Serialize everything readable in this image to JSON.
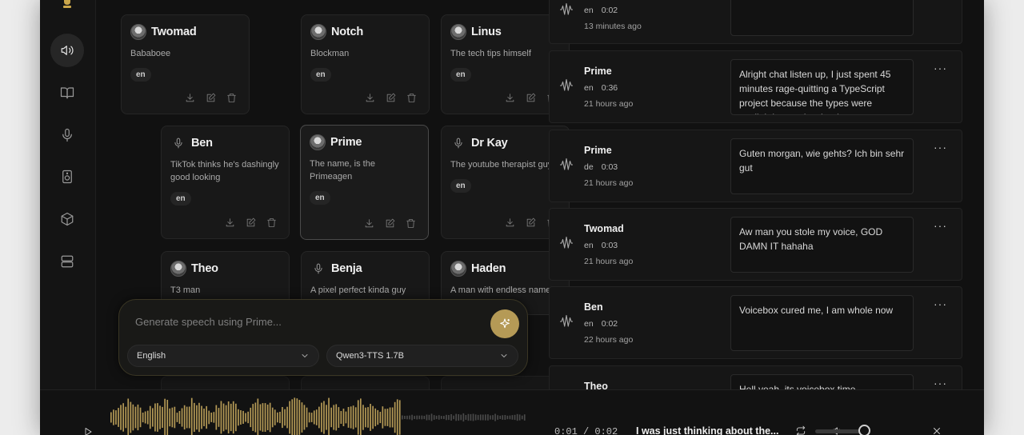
{
  "sidebar": {
    "items": [
      {
        "name": "sidebar-item-voices",
        "icon": "speaker-icon"
      },
      {
        "name": "sidebar-item-docs",
        "icon": "book-icon"
      },
      {
        "name": "sidebar-item-record",
        "icon": "microphone-icon"
      },
      {
        "name": "sidebar-item-audio",
        "icon": "audio-device-icon"
      },
      {
        "name": "sidebar-item-models",
        "icon": "cube-icon"
      },
      {
        "name": "sidebar-item-server",
        "icon": "server-icon"
      }
    ]
  },
  "voices": [
    {
      "name": "Twomad",
      "description": "Bababoee",
      "lang": "en",
      "avatar": "photo"
    },
    {
      "name": "Notch",
      "description": "Blockman",
      "lang": "en",
      "avatar": "photo"
    },
    {
      "name": "Linus",
      "description": "The tech tips himself",
      "lang": "en",
      "avatar": "photo"
    },
    {
      "name": "Ben",
      "description": "TikTok thinks he's dashingly good looking",
      "lang": "en",
      "avatar": "mic"
    },
    {
      "name": "Prime",
      "description": "The name, is the Primeagen",
      "lang": "en",
      "avatar": "photo",
      "selected": true
    },
    {
      "name": "Dr Kay",
      "description": "The youtube therapist guy",
      "lang": "en",
      "avatar": "mic"
    },
    {
      "name": "Theo",
      "description": "T3 man",
      "lang": "",
      "avatar": "photo"
    },
    {
      "name": "Benja",
      "description": "A pixel perfect kinda guy",
      "lang": "",
      "avatar": "mic"
    },
    {
      "name": "Haden",
      "description": "A man with endless names",
      "lang": "",
      "avatar": "photo"
    }
  ],
  "composer": {
    "placeholder": "Generate speech using Prime...",
    "language": "English",
    "model": "Qwen3-TTS 1.7B",
    "accent_color": "#b59a56"
  },
  "history": [
    {
      "name": "",
      "lang": "en",
      "duration": "0:02",
      "time": "13 minutes ago",
      "text": ""
    },
    {
      "name": "Prime",
      "lang": "en",
      "duration": "0:36",
      "time": "21 hours ago",
      "text": "Alright chat listen up, I just spent 45 minutes rage-quitting a TypeScript project because the types were gaslighting me harder than my ex"
    },
    {
      "name": "Prime",
      "lang": "de",
      "duration": "0:03",
      "time": "21 hours ago",
      "text": "Guten morgan, wie gehts? Ich bin sehr gut"
    },
    {
      "name": "Twomad",
      "lang": "en",
      "duration": "0:03",
      "time": "21 hours ago",
      "text": "Aw man you stole my voice, GOD DAMN IT hahaha"
    },
    {
      "name": "Ben",
      "lang": "en",
      "duration": "0:02",
      "time": "22 hours ago",
      "text": "Voicebox cured me, I am whole now"
    },
    {
      "name": "Theo",
      "lang": "",
      "duration": "",
      "time": "",
      "text": "Hell yeah, its voicebox time"
    }
  ],
  "player": {
    "time": "0:01 / 0:02",
    "title": "I was just thinking about the...",
    "progress": 0.5,
    "volume": 0.82
  },
  "more_label": "···"
}
